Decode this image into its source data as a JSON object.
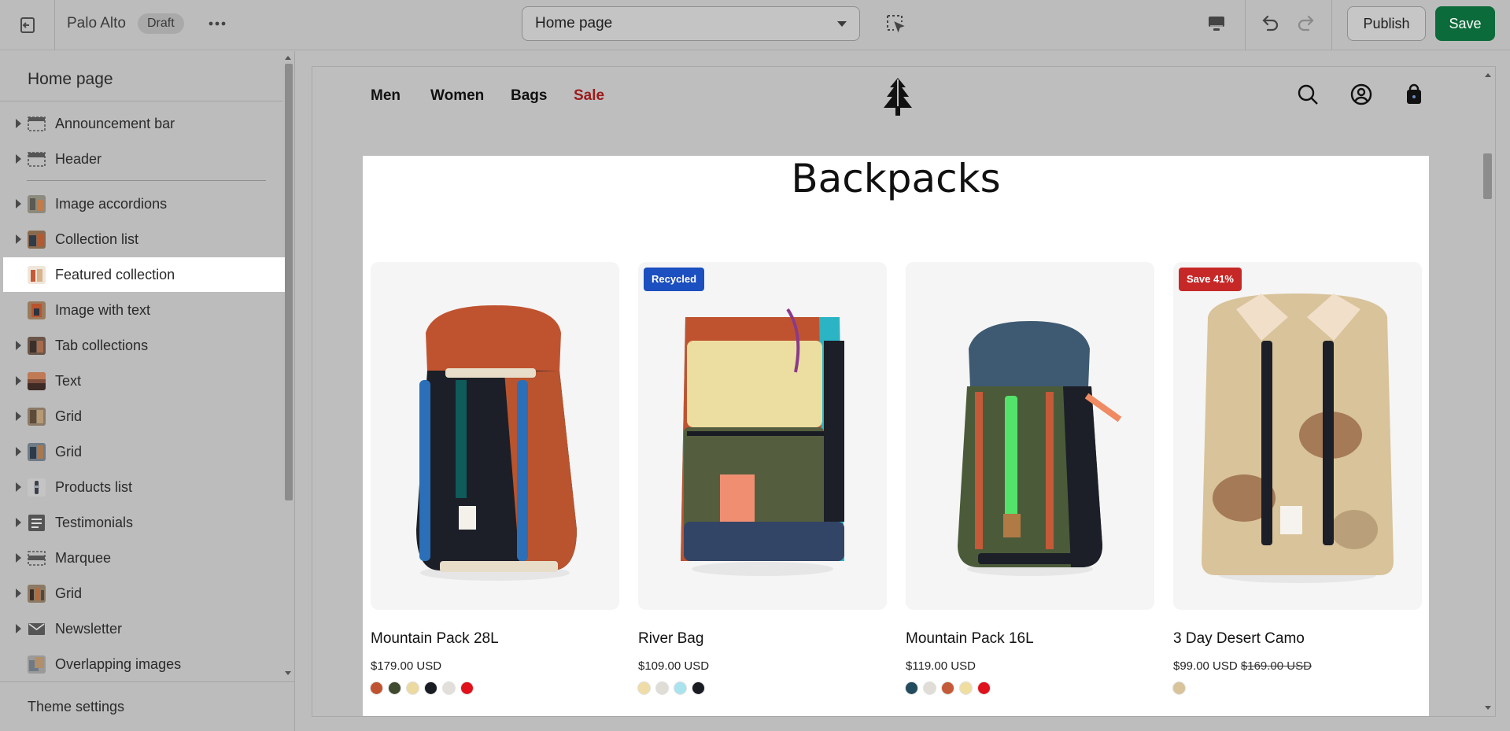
{
  "topbar": {
    "store_name": "Palo Alto",
    "status_badge": "Draft",
    "page_selector": "Home page",
    "publish_label": "Publish",
    "save_label": "Save"
  },
  "sidebar": {
    "title": "Home page",
    "items": [
      {
        "label": "Announcement bar",
        "icon": "layout-bar-icon",
        "expandable": true
      },
      {
        "label": "Header",
        "icon": "layout-header-icon",
        "expandable": true
      },
      {
        "label": "Image accordions",
        "icon": "image-thumb-icon",
        "expandable": true
      },
      {
        "label": "Collection list",
        "icon": "image-thumb-icon",
        "expandable": true
      },
      {
        "label": "Featured collection",
        "icon": "image-thumb-icon",
        "expandable": false,
        "selected": true
      },
      {
        "label": "Image with text",
        "icon": "image-thumb-icon",
        "expandable": false
      },
      {
        "label": "Tab collections",
        "icon": "image-thumb-icon",
        "expandable": true
      },
      {
        "label": "Text",
        "icon": "image-thumb-icon",
        "expandable": true
      },
      {
        "label": "Grid",
        "icon": "image-thumb-icon",
        "expandable": true
      },
      {
        "label": "Grid",
        "icon": "image-thumb-icon",
        "expandable": true
      },
      {
        "label": "Products list",
        "icon": "image-thumb-icon",
        "expandable": true
      },
      {
        "label": "Testimonials",
        "icon": "text-block-icon",
        "expandable": true
      },
      {
        "label": "Marquee",
        "icon": "layout-bar-icon",
        "expandable": true
      },
      {
        "label": "Grid",
        "icon": "image-thumb-icon",
        "expandable": true
      },
      {
        "label": "Newsletter",
        "icon": "mail-icon",
        "expandable": true
      },
      {
        "label": "Overlapping images",
        "icon": "image-thumb-icon",
        "expandable": false
      }
    ],
    "footer": "Theme settings"
  },
  "preview": {
    "nav": [
      "Men",
      "Women",
      "Bags",
      "Sale"
    ],
    "section_title": "Backpacks",
    "products": [
      {
        "name": "Mountain Pack 28L",
        "price": "$179.00 USD",
        "compare_price": "",
        "badge": "",
        "swatches": [
          "#c0532f",
          "#3f4a2e",
          "#ecd9a0",
          "#1a1c24",
          "#e2dfda",
          "#e0111a"
        ]
      },
      {
        "name": "River Bag",
        "price": "$109.00 USD",
        "compare_price": "",
        "badge": "Recycled",
        "swatches": [
          "#efdca7",
          "#e0dcd6",
          "#a8e3ee",
          "#1a1c24"
        ]
      },
      {
        "name": "Mountain Pack 16L",
        "price": "$119.00 USD",
        "compare_price": "",
        "badge": "",
        "swatches": [
          "#234b5e",
          "#e0dcd6",
          "#c45a37",
          "#f0dea0",
          "#e0111a"
        ]
      },
      {
        "name": "3 Day Desert Camo",
        "price": "$99.00 USD",
        "compare_price": "$169.00 USD",
        "badge": "Save 41%",
        "swatches": [
          "#d8c39a"
        ]
      }
    ]
  },
  "colors": {
    "save_green": "#0b6b3a",
    "sale_red": "#9a1b1b",
    "badge_blue": "#1c4fbf",
    "badge_red": "#c62828"
  }
}
